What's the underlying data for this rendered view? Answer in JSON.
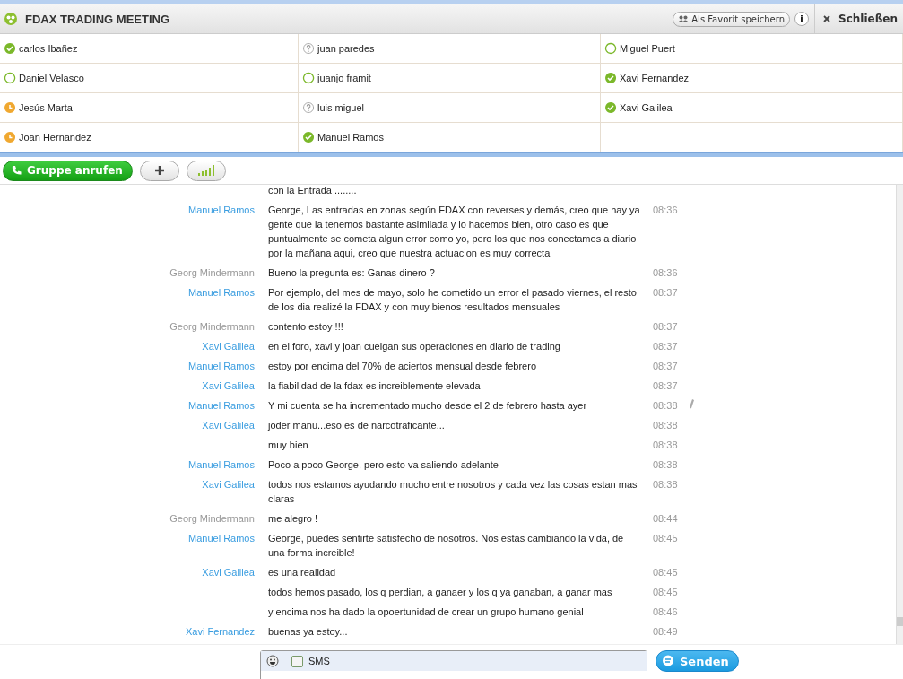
{
  "window": {
    "title": "FDAX TRADING MEETING",
    "favorite_button": "Als Favorit speichern",
    "info_button": "i",
    "close_button": "Schließen"
  },
  "participants": [
    {
      "name": "carlos Ibañez",
      "kind": "online"
    },
    {
      "name": "juan paredes",
      "kind": "unknown"
    },
    {
      "name": "Miguel Puert",
      "kind": "offline"
    },
    {
      "name": "Daniel Velasco",
      "kind": "offline"
    },
    {
      "name": "juanjo framit",
      "kind": "offline"
    },
    {
      "name": "Xavi Fernandez",
      "kind": "online"
    },
    {
      "name": "Jesús Marta",
      "kind": "away"
    },
    {
      "name": "luis miguel",
      "kind": "unknown"
    },
    {
      "name": "Xavi Galilea",
      "kind": "online"
    },
    {
      "name": "Joan Hernandez",
      "kind": "away"
    },
    {
      "name": "Manuel Ramos",
      "kind": "online"
    }
  ],
  "toolbar": {
    "call_button": "Gruppe anrufen"
  },
  "messages": [
    {
      "text": "con la   Entrada ........",
      "edited": false
    },
    {
      "sender": "Manuel Ramos",
      "kind": "member",
      "text": "George, Las entradas en zonas según FDAX con reverses y demás, creo que hay ya gente que la tenemos bastante asimilada y lo hacemos bien, otro caso es que puntualmente se cometa algun error como yo, pero los que nos conectamos a diario por la mañana aqui, creo que nuestra actuacion es muy correcta",
      "time": "08:36",
      "edited": false
    },
    {
      "sender": "Georg Mindermann",
      "kind": "host",
      "text": "Bueno la pregunta es: Ganas dinero ?",
      "time": "08:36",
      "edited": false
    },
    {
      "sender": "Manuel Ramos",
      "kind": "member",
      "text": "Por ejemplo, del mes de mayo, solo he cometido un error el pasado viernes, el resto de los dia realizé la FDAX y con muy bienos resultados mensuales",
      "time": "08:37",
      "edited": false
    },
    {
      "sender": "Georg Mindermann",
      "kind": "host",
      "text": "contento estoy !!!",
      "time": "08:37",
      "edited": false
    },
    {
      "sender": "Xavi Galilea",
      "kind": "member",
      "text": "en el foro, xavi y joan cuelgan sus operaciones en diario de trading",
      "time": "08:37",
      "edited": false
    },
    {
      "sender": "Manuel Ramos",
      "kind": "member",
      "text": "estoy por encima del 70% de aciertos mensual desde febrero",
      "time": "08:37",
      "edited": false
    },
    {
      "sender": "Xavi Galilea",
      "kind": "member",
      "text": "la fiabilidad de la fdax es increiblemente elevada",
      "time": "08:37",
      "edited": false
    },
    {
      "sender": "Manuel Ramos",
      "kind": "member",
      "text": "Y mi cuenta se ha incrementado mucho desde el 2 de febrero hasta ayer",
      "time": "08:38",
      "edited": true
    },
    {
      "sender": "Xavi Galilea",
      "kind": "member",
      "text": "joder manu...eso es de narcotraficante...",
      "time": "08:38",
      "edited": false
    },
    {
      "text": "muy bien",
      "time": "08:38",
      "edited": false
    },
    {
      "sender": "Manuel Ramos",
      "kind": "member",
      "text": "Poco a poco George, pero esto va saliendo adelante",
      "time": "08:38",
      "edited": false
    },
    {
      "sender": "Xavi Galilea",
      "kind": "member",
      "text": "todos nos estamos ayudando mucho entre nosotros y cada vez las cosas estan mas claras",
      "time": "08:38",
      "edited": false
    },
    {
      "sender": "Georg Mindermann",
      "kind": "host",
      "text": "me alegro !",
      "time": "08:44",
      "edited": false
    },
    {
      "sender": "Manuel Ramos",
      "kind": "member",
      "text": "George, puedes sentirte satisfecho de nosotros. Nos estas cambiando la vida, de una forma increible!",
      "time": "08:45",
      "edited": false
    },
    {
      "sender": "Xavi Galilea",
      "kind": "member",
      "text": "es una realidad",
      "time": "08:45",
      "edited": false
    },
    {
      "text": "todos hemos pasado, los q perdian, a ganaer y los q ya ganaban, a ganar mas",
      "time": "08:45",
      "edited": false
    },
    {
      "text": "y encima nos ha dado la opoertunidad de crear un grupo humano genial",
      "time": "08:46",
      "edited": false
    },
    {
      "sender": "Xavi Fernandez",
      "kind": "member",
      "text": "buenas ya estoy...",
      "time": "08:49",
      "edited": false
    }
  ],
  "composer": {
    "sms_label": "SMS",
    "sms_checked": false,
    "send_button": "Senden"
  }
}
